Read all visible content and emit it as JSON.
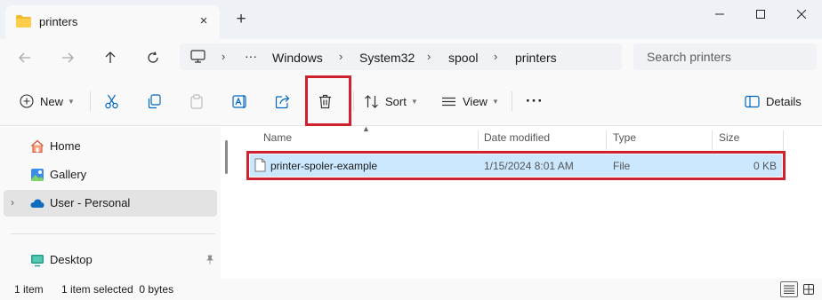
{
  "tab": {
    "title": "printers",
    "close_icon": "×",
    "new_tab_icon": "+"
  },
  "breadcrumb": {
    "overflow": "···",
    "separator": "›",
    "items": [
      "Windows",
      "System32",
      "spool",
      "printers"
    ]
  },
  "search": {
    "placeholder": "Search printers"
  },
  "command_bar": {
    "new_label": "New",
    "sort_label": "Sort",
    "view_label": "View",
    "more_label": "···",
    "details_label": "Details"
  },
  "sidebar": {
    "items": [
      {
        "label": "Home",
        "icon": "home-icon"
      },
      {
        "label": "Gallery",
        "icon": "gallery-icon"
      },
      {
        "label": "User - Personal",
        "icon": "onedrive-icon",
        "selected": true
      },
      {
        "label": "Desktop",
        "icon": "desktop-icon",
        "pinned": true
      }
    ]
  },
  "file_list": {
    "columns": [
      "Name",
      "Date modified",
      "Type",
      "Size"
    ],
    "rows": [
      {
        "name": "printer-spoler-example",
        "date": "1/15/2024 8:01 AM",
        "type": "File",
        "size": "0 KB",
        "selected": true
      }
    ]
  },
  "status": {
    "item_count": "1 item",
    "selection": "1 item selected  0 bytes"
  },
  "colors": {
    "accent": "#0067c0",
    "highlight_box": "#d0212e",
    "selection": "#cce8ff"
  }
}
